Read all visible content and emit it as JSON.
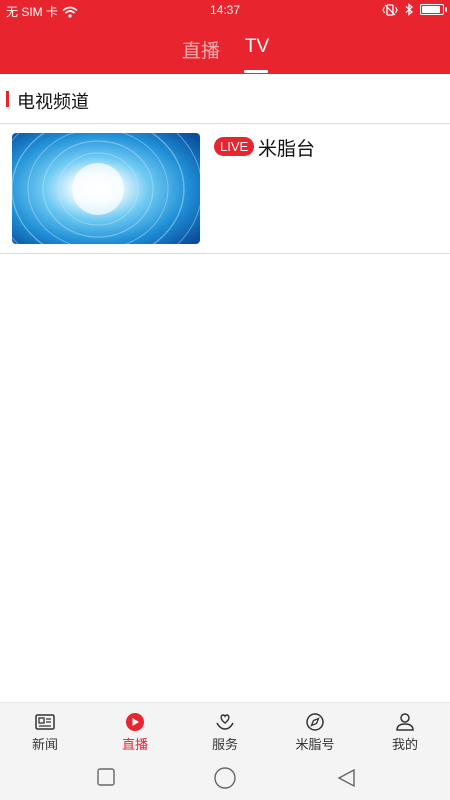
{
  "status_bar": {
    "carrier": "无 SIM 卡",
    "time": "14:37",
    "battery_level": 0.92,
    "icons": [
      "wifi-icon",
      "vibrate-icon",
      "bluetooth-icon",
      "battery-icon"
    ]
  },
  "top_tabs": [
    {
      "label": "直播",
      "selected": false
    },
    {
      "label": "TV",
      "selected": true
    }
  ],
  "section": {
    "title": "电视频道"
  },
  "channels": [
    {
      "badge": "LIVE",
      "name": "米脂台",
      "thumbnail": "blue-swirl-thumbnail"
    }
  ],
  "bottom_tabs": [
    {
      "label": "新闻",
      "icon": "newspaper-icon",
      "active": false
    },
    {
      "label": "直播",
      "icon": "play-icon",
      "active": true
    },
    {
      "label": "服务",
      "icon": "heart-hand-icon",
      "active": false
    },
    {
      "label": "米脂号",
      "icon": "compass-icon",
      "active": false
    },
    {
      "label": "我的",
      "icon": "user-icon",
      "active": false
    }
  ],
  "system_nav": [
    "recents-square-icon",
    "home-circle-icon",
    "back-triangle-icon"
  ],
  "colors": {
    "brand_red": "#e8252e",
    "active_tab": "#e8252e",
    "bar_background": "#f4f4f4",
    "divider": "#dcdcdc"
  }
}
